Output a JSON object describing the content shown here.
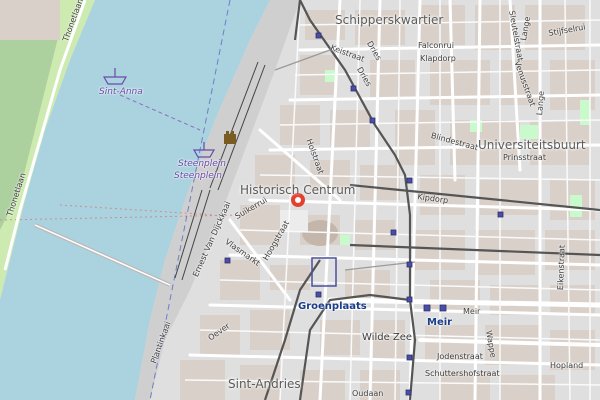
{
  "map": {
    "colors": {
      "river": "#aad3df",
      "park": "#add19e",
      "grass": "#cdebb0",
      "urban": "#e0dfdf",
      "buildings": "#d9d0c9",
      "road": "#ffffff",
      "tram": "#555555",
      "metro": "#4a4fa0",
      "marker": "#e4402f"
    },
    "districts": {
      "schipperskwartier": "Schipperskwartier",
      "historisch_centrum": "Historisch Centrum",
      "universiteitsbuurt": "Universiteitsbuurt",
      "sint_andries": "Sint-Andries"
    },
    "pois": {
      "sint_anna": "Sint-Anna",
      "steenplein_1": "Steenplein",
      "steenplein_2": "Steenplein"
    },
    "stations": {
      "groenplaats": "Groenplaats",
      "meir": "Meir"
    },
    "streets": {
      "thonetlaan": "Thonetlaan",
      "thonetlaan_2": "Thonetlaan",
      "falconrui": "Falconrui",
      "klapdorp": "Klapdorp",
      "keistraat": "Keistraat",
      "dries": "Dries",
      "driesch": "Dries",
      "blindestraat": "Blindestraat",
      "prinsstraat": "Prinsstraat",
      "kipdorp": "Kipdorp",
      "holstraat": "Holstraat",
      "suikerrui": "Suikerrui",
      "hoogstraat": "Hoogstraat",
      "vlasmarkt": "Vlasmarkt",
      "ernest_van_dijckkaai": "Ernest Van Dijckkaai",
      "plantinkaai": "Plantinkaai",
      "oever": "Oever",
      "wilde_zee": "Wilde Zee",
      "meir_street": "Meir",
      "jodenstraat": "Jodenstraat",
      "schuttershofstraat": "Schuttershofstraat",
      "hopland": "Hopland",
      "eikenstraat": "Eikenstraat",
      "wappe": "Wappe",
      "stijfselrui": "Stijfselrui",
      "venusstraat": "Venusstraat",
      "lange_nieuwstraat": "Lange",
      "oudaan": "Oudaan",
      "sleutelstraat": "Sleutelstraat",
      "lange_2": "Lange"
    }
  }
}
